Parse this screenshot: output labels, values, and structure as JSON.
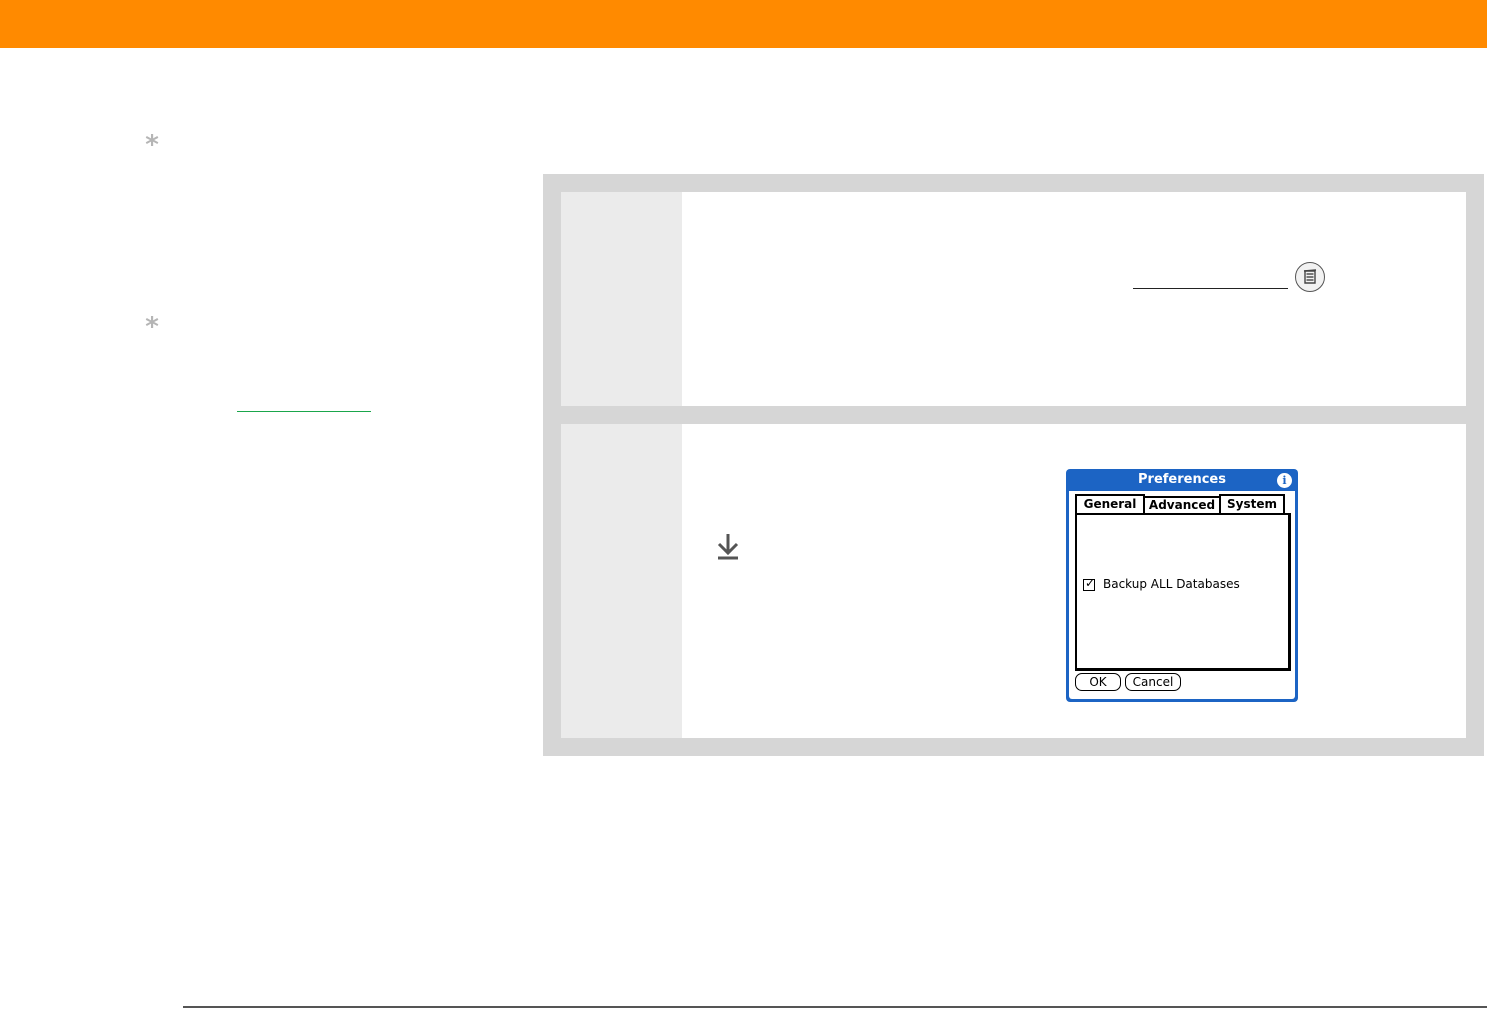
{
  "colors": {
    "header_bar": "#ff8a00",
    "tip_link": "#1aa64b",
    "dialog_blue": "#1c64c4"
  },
  "icons": {
    "tip_asterisk": "tip-asterisk-icon",
    "menu": "menu-icon",
    "scroll_down": "down-arrow-icon",
    "info": "info-icon"
  },
  "tips": [
    {
      "symbol": "*"
    },
    {
      "symbol": "*"
    }
  ],
  "dialog": {
    "title": "Preferences",
    "info_glyph": "i",
    "tabs": [
      "General",
      "Advanced",
      "System"
    ],
    "selected_tab": "System",
    "checkbox": {
      "label": "Backup ALL Databases",
      "checked": true,
      "mark": "✓"
    },
    "ok_label": "OK",
    "cancel_label": "Cancel"
  }
}
